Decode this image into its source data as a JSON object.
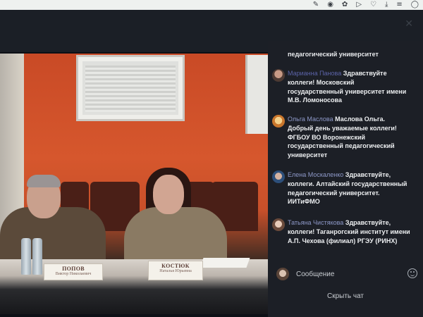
{
  "toolbar": {
    "icons": [
      "edit-icon",
      "camera-icon",
      "puzzle-icon",
      "play-icon",
      "heart-icon",
      "download-icon",
      "menu-icon",
      "profile-icon"
    ],
    "glyphs": [
      "✎",
      "◉",
      "✿",
      "▷",
      "♡",
      "⤓",
      "≡",
      "◯"
    ]
  },
  "video": {
    "nameplate_left": {
      "line1": "ПОПОВ",
      "line2": "Виктор Николаевич"
    },
    "nameplate_right": {
      "line1": "КОСТЮК",
      "line2": "Наталья Юрьевна"
    }
  },
  "chat": {
    "overflow_text": "педагогический университет",
    "messages": [
      {
        "author": "Марианна Панова",
        "text": "Здравствуйте коллеги! Московский государственный университет имени М.В. Ломоносова"
      },
      {
        "author": "Ольга Маслова",
        "text": "Маслова Ольга. Добрый день уважаемые коллеги! ФГБОУ ВО Воронежский государственный педагогический университет"
      },
      {
        "author": "Елена Москаленко",
        "text": "Здравствуйте, коллеги. Алтайский государственный педагогический университет. ИИТиФМО"
      },
      {
        "author": "Татьяна Чистякова",
        "text": "Здравствуйте, коллеги! Таганрогский институт имени А.П. Чехова (филиал) РГЭУ (РИНХ)"
      }
    ],
    "composer_placeholder": "Сообщение",
    "hide_chat_label": "Скрыть чат"
  },
  "colors": {
    "chat_bg": "#1c1f26",
    "author_link": "#8e99c9",
    "wall_orange": "#d6572d"
  }
}
